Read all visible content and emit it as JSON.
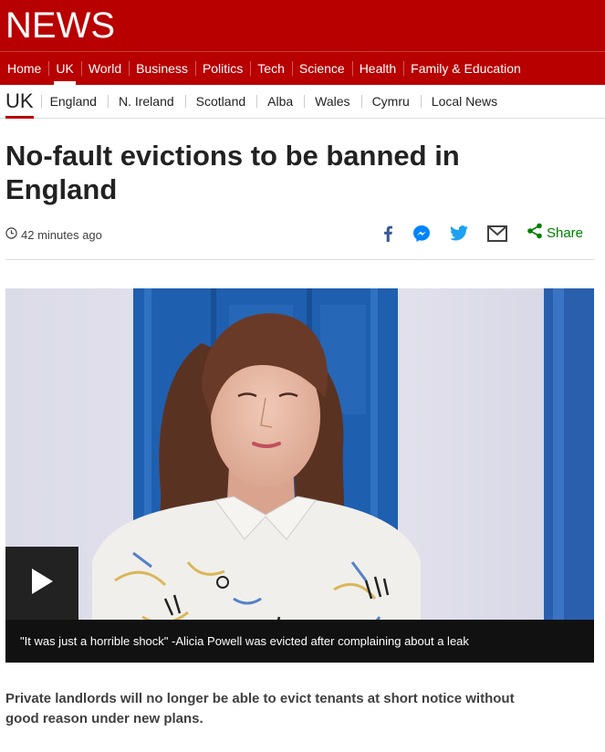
{
  "masthead": {
    "logo": "NEWS"
  },
  "nav": {
    "items": [
      "Home",
      "UK",
      "World",
      "Business",
      "Politics",
      "Tech",
      "Science",
      "Health",
      "Family & Education"
    ],
    "active": "UK"
  },
  "subnav": {
    "section": "UK",
    "items": [
      "England",
      "N. Ireland",
      "Scotland",
      "Alba",
      "Wales",
      "Cymru",
      "Local News"
    ]
  },
  "article": {
    "headline": "No-fault evictions to be banned in England",
    "timestamp": "42 minutes ago",
    "share_label": "Share",
    "share_icons": [
      "facebook-icon",
      "messenger-icon",
      "twitter-icon",
      "email-icon",
      "share-icon"
    ],
    "caption": "\"It was just a horrible shock\" -Alicia Powell was evicted after complaining about a leak",
    "intro": "Private landlords will no longer be able to evict tenants at short notice without good reason under new plans."
  },
  "colors": {
    "brand_red": "#b80000",
    "share_green": "#008000",
    "facebook_blue": "#3b5998",
    "messenger_blue": "#0084ff",
    "twitter_blue": "#1da1f2"
  }
}
